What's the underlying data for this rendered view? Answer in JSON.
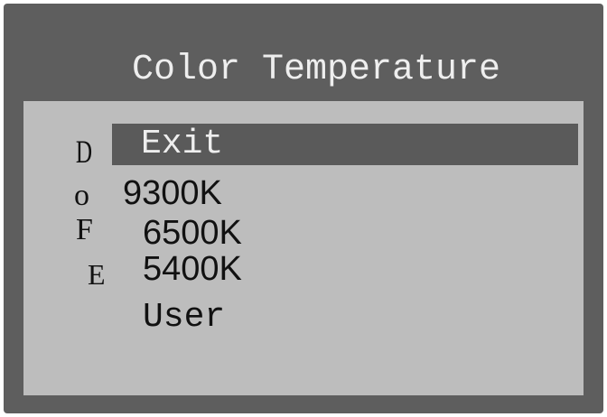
{
  "osd": {
    "title": "Color Temperature",
    "side_glyphs": [
      "D",
      "o",
      "F",
      "E"
    ],
    "items": [
      {
        "label": "Exit",
        "selected": true
      },
      {
        "label": "9300K",
        "selected": false
      },
      {
        "label": "6500K",
        "selected": false
      },
      {
        "label": "5400K",
        "selected": false
      },
      {
        "label": "User",
        "selected": false
      }
    ]
  },
  "colors": {
    "frame": "#5e5e5e",
    "panel": "#bdbdbd",
    "highlight": "#5a5a5a",
    "title_text": "#eeeeee",
    "item_text": "#111111"
  }
}
